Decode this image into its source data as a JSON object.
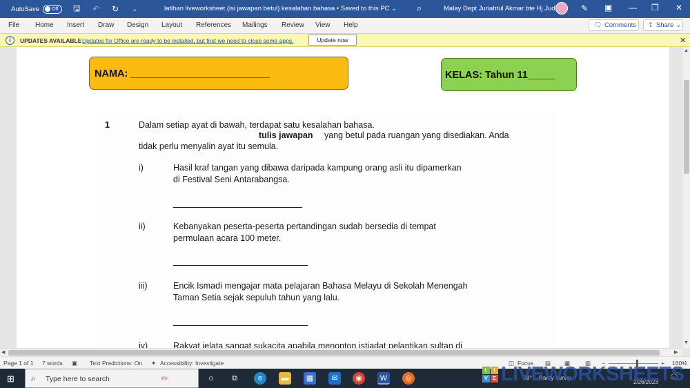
{
  "titlebar": {
    "autosave_label": "AutoSave",
    "autosave_state": "Off",
    "doc_title": "latihan liveworksheet (isi jawapan betul) kesalahan bahasa  •  Saved to this PC ⌄",
    "user_name": "Malay Dept Juriahtul Akmar bte Hj Judin"
  },
  "menu": {
    "items": [
      "File",
      "Home",
      "Insert",
      "Draw",
      "Design",
      "Layout",
      "References",
      "Mailings",
      "Review",
      "View",
      "Help"
    ],
    "comments_label": "Comments",
    "share_label": "Share"
  },
  "update_bar": {
    "title": "UPDATES AVAILABLE",
    "message": "Updates for Office are ready to be installed, but first we need to close some apps.",
    "button_label": "Update now"
  },
  "document": {
    "nama_label": "NAMA: _________________________",
    "kelas_label": "KELAS: Tahun 11_____",
    "question_number": "1",
    "intro_line1": "Dalam setiap ayat di bawah, terdapat satu kesalahan bahasa.",
    "intro_line2_bold": "tulis jawapan",
    "intro_line2_rest": "yang betul pada ruangan yang disediakan. Anda",
    "intro_line3": "tidak perlu menyalin ayat itu semula.",
    "items": [
      {
        "num": "i)",
        "line1": "Hasil kraf tangan yang dibawa  daripada kampung orang asli itu dipamerkan",
        "line2": "di Festival Seni Antarabangsa."
      },
      {
        "num": "ii)",
        "line1": "Kebanyakan   peserta-peserta   pertandingan   sudah   bersedia   di   tempat",
        "line2": "permulaan acara 100 meter."
      },
      {
        "num": "iii)",
        "line1": "Encik Ismadi mengajar mata pelajaran Bahasa Melayu di Sekolah Menengah",
        "line2": "Taman Setia sejak sepuluh tahun yang lalu."
      },
      {
        "num": "iv)",
        "line1": "Rakyat jelata sangat sukacita apabila menonton istiadat pelantikan sultan di",
        "line2": ""
      }
    ]
  },
  "statusbar": {
    "page": "Page 1 of 1",
    "words": "7 words",
    "text_predictions": "Text Predictions: On",
    "accessibility": "Accessibility: Investigate",
    "focus": "Focus",
    "zoom": "160%"
  },
  "taskbar": {
    "search_placeholder": "Type here to search",
    "weather": "28°",
    "weather_desc": "Partly sunny",
    "date": "2/26/2023",
    "watermark": "LIVEWORKSHEETS"
  },
  "colors": {
    "titlebar": "#2b579a",
    "nama_box": "#fcbb11",
    "kelas_box": "#8cd14f",
    "update_bar": "#fcf7b6"
  }
}
